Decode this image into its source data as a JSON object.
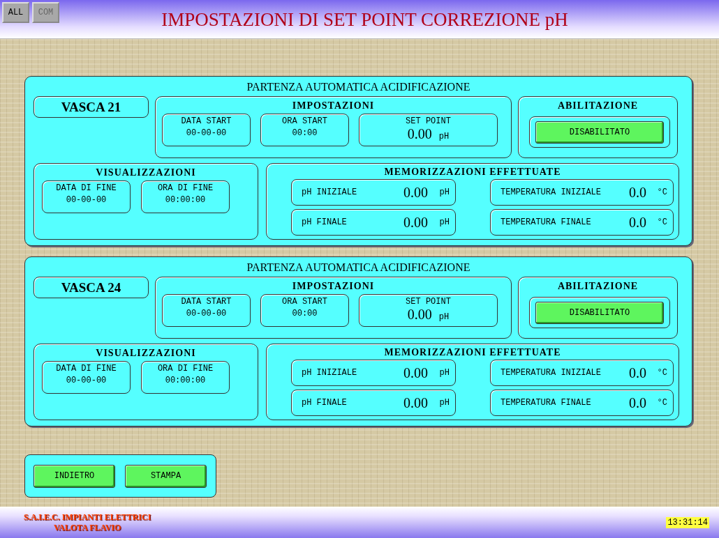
{
  "header": {
    "buttons": [
      {
        "label": "ALL",
        "disabled": false
      },
      {
        "label": "COM",
        "disabled": true
      }
    ],
    "title": "IMPOSTAZIONI DI SET POINT CORREZIONE pH"
  },
  "tanks": [
    {
      "heading": "PARTENZA AUTOMATICA ACIDIFICAZIONE",
      "name": "VASCA 21",
      "settings": {
        "title": "IMPOSTAZIONI",
        "fields": [
          {
            "label": "DATA START",
            "value": "00-00-00"
          },
          {
            "label": "ORA START",
            "value": "00:00"
          }
        ],
        "set_point": {
          "label": "SET POINT",
          "value": "0.00",
          "unit": "pH"
        }
      },
      "enable": {
        "title": "ABILITAZIONE",
        "button": "DISABILITATO"
      },
      "display": {
        "title": "VISUALIZZAZIONI",
        "fields": [
          {
            "label": "DATA DI FINE",
            "value": "00-00-00"
          },
          {
            "label": "ORA DI FINE",
            "value": "00:00:00"
          }
        ]
      },
      "stored": {
        "title": "MEMORIZZAZIONI EFFETTUATE",
        "readings": [
          {
            "label": "pH INIZIALE",
            "value": "0.00",
            "unit": "pH"
          },
          {
            "label": "TEMPERATURA INIZIALE",
            "value": "0.0",
            "unit": "°C"
          },
          {
            "label": "pH FINALE",
            "value": "0.00",
            "unit": "pH"
          },
          {
            "label": "TEMPERATURA FINALE",
            "value": "0.0",
            "unit": "°C"
          }
        ]
      }
    },
    {
      "heading": "PARTENZA AUTOMATICA ACIDIFICAZIONE",
      "name": "VASCA 24",
      "settings": {
        "title": "IMPOSTAZIONI",
        "fields": [
          {
            "label": "DATA START",
            "value": "00-00-00"
          },
          {
            "label": "ORA START",
            "value": "00:00"
          }
        ],
        "set_point": {
          "label": "SET POINT",
          "value": "0.00",
          "unit": "pH"
        }
      },
      "enable": {
        "title": "ABILITAZIONE",
        "button": "DISABILITATO"
      },
      "display": {
        "title": "VISUALIZZAZIONI",
        "fields": [
          {
            "label": "DATA DI FINE",
            "value": "00-00-00"
          },
          {
            "label": "ORA DI FINE",
            "value": "00:00:00"
          }
        ]
      },
      "stored": {
        "title": "MEMORIZZAZIONI EFFETTUATE",
        "readings": [
          {
            "label": "pH INIZIALE",
            "value": "0.00",
            "unit": "pH"
          },
          {
            "label": "TEMPERATURA INIZIALE",
            "value": "0.0",
            "unit": "°C"
          },
          {
            "label": "pH FINALE",
            "value": "0.00",
            "unit": "pH"
          },
          {
            "label": "TEMPERATURA FINALE",
            "value": "0.0",
            "unit": "°C"
          }
        ]
      }
    }
  ],
  "actions": [
    "INDIETRO",
    "STAMPA"
  ],
  "footer": {
    "company": "S.A.I.E.C. IMPIANTI ELETTRICI",
    "owner": "VALOTA FLAVIO",
    "clock": "13:31:14"
  }
}
